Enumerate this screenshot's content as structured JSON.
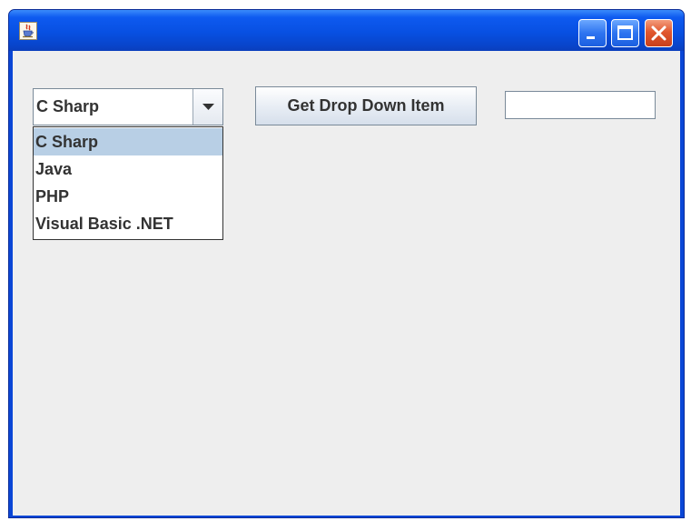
{
  "window": {
    "title": "",
    "icon": "java-cup-icon",
    "controls": {
      "minimize_icon": "minimize-icon",
      "maximize_icon": "maximize-icon",
      "close_icon": "close-icon"
    },
    "colors": {
      "titlebar": "#0850e2",
      "content_background": "#eeeeee",
      "close_button": "#e1582f"
    }
  },
  "combo": {
    "selected_value": "C Sharp",
    "expanded": true,
    "arrow_icon": "chevron-down-icon",
    "options": [
      {
        "label": "C Sharp",
        "selected": true
      },
      {
        "label": "Java",
        "selected": false
      },
      {
        "label": "PHP",
        "selected": false
      },
      {
        "label": "Visual Basic .NET",
        "selected": false
      }
    ],
    "highlight_color": "#b8cfe5"
  },
  "button": {
    "label": "Get Drop Down Item"
  },
  "text_field": {
    "value": "",
    "placeholder": ""
  }
}
